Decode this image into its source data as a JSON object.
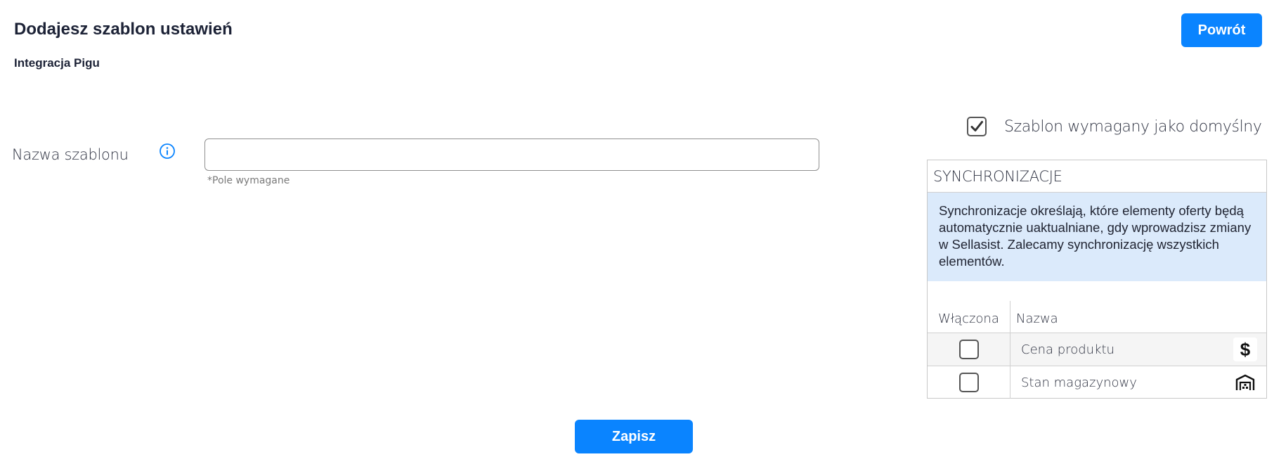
{
  "header": {
    "title": "Dodajesz szablon ustawień",
    "subtitle": "Integracja Pigu",
    "back_label": "Powrót"
  },
  "form": {
    "name_label": "Nazwa szablonu",
    "name_value": "",
    "required_hint": "*Pole wymagane",
    "save_label": "Zapisz"
  },
  "default_template": {
    "label": "Szablon wymagany jako domyślny",
    "checked": true
  },
  "sync": {
    "title": "SYNCHRONIZACJE",
    "info": "Synchronizacje określają, które elementy oferty będą automatycznie uaktualniane, gdy wprowadzisz zmiany w Sellasist. Zalecamy synchronizację wszystkich elementów.",
    "columns": [
      "Włączona",
      "Nazwa"
    ],
    "rows": [
      {
        "name": "Cena produktu",
        "enabled": false,
        "icon": "dollar-icon"
      },
      {
        "name": "Stan magazynowy",
        "enabled": false,
        "icon": "warehouse-icon"
      }
    ]
  },
  "colors": {
    "accent": "#0a84ff",
    "info_bg": "#dbeafb"
  }
}
